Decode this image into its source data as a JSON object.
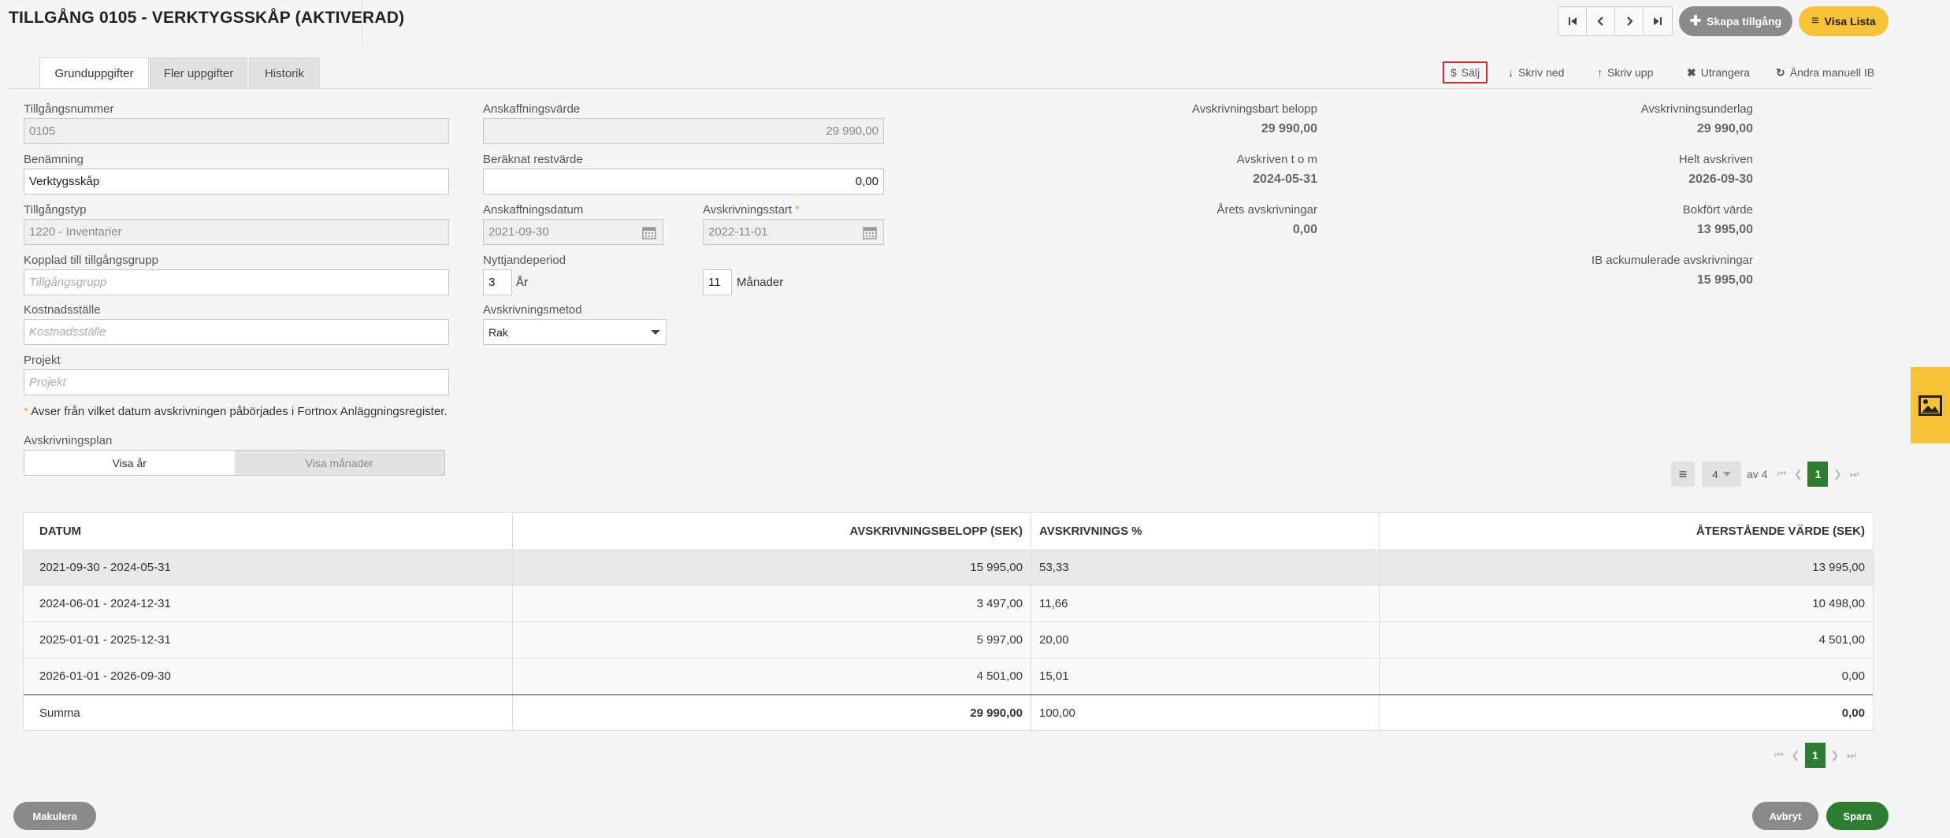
{
  "header": {
    "title": "TILLGÅNG 0105 - VERKTYGSSKÅP (AKTIVERAD)",
    "create_label": "Skapa tillgång",
    "list_label": "Visa Lista"
  },
  "tabs": [
    {
      "label": "Grunduppgifter"
    },
    {
      "label": "Fler uppgifter"
    },
    {
      "label": "Historik"
    }
  ],
  "actions": {
    "sell": "Sälj",
    "write_down": "Skriv ned",
    "write_up": "Skriv upp",
    "dispose": "Utrangera",
    "change_ib": "Ändra manuell IB"
  },
  "form": {
    "asset_number_label": "Tillgångsnummer",
    "asset_number": "0105",
    "name_label": "Benämning",
    "name": "Verktygsskåp",
    "type_label": "Tillgångstyp",
    "type": "1220 - Inventarier",
    "group_label": "Kopplad till tillgångsgrupp",
    "group_placeholder": "Tillgångsgrupp",
    "cost_center_label": "Kostnadsställe",
    "cost_center_placeholder": "Kostnadsställe",
    "project_label": "Projekt",
    "project_placeholder": "Projekt",
    "acq_value_label": "Anskaffningsvärde",
    "acq_value": "29 990,00",
    "residual_label": "Beräknat restvärde",
    "residual": "0,00",
    "acq_date_label": "Anskaffningsdatum",
    "acq_date": "2021-09-30",
    "dep_start_label": "Avskrivningsstart",
    "dep_start": "2022-11-01",
    "useful_life_label": "Nyttjandeperiod",
    "years": "3",
    "years_unit": "År",
    "months": "11",
    "months_unit": "Månader",
    "method_label": "Avskrivningsmetod",
    "method": "Rak",
    "note_star": "*",
    "note": "Avser från vilket datum avskrivningen påbörjades i Fortnox Anläggningsregister.",
    "plan_label": "Avskrivningsplan",
    "view_year": "Visa år",
    "view_month": "Visa månader"
  },
  "summary": {
    "depreciable_label": "Avskrivningsbart belopp",
    "depreciable": "29 990,00",
    "basis_label": "Avskrivningsunderlag",
    "basis": "29 990,00",
    "depreciated_to_label": "Avskriven t o m",
    "depreciated_to": "2024-05-31",
    "fully_label": "Helt avskriven",
    "fully": "2026-09-30",
    "year_dep_label": "Årets avskrivningar",
    "year_dep": "0,00",
    "book_value_label": "Bokfört värde",
    "book_value": "13 995,00",
    "ib_label": "IB ackumulerade avskrivningar",
    "ib": "15 995,00"
  },
  "pager": {
    "per_page": "4",
    "of_text": "av 4",
    "page": "1"
  },
  "table": {
    "headers": [
      "DATUM",
      "AVSKRIVNINGSBELOPP (SEK)",
      "AVSKRIVNINGS %",
      "ÅTERSTÅENDE VÄRDE (SEK)"
    ],
    "rows": [
      [
        "2021-09-30 - 2024-05-31",
        "15 995,00",
        "53,33",
        "13 995,00"
      ],
      [
        "2024-06-01 - 2024-12-31",
        "3 497,00",
        "11,66",
        "10 498,00"
      ],
      [
        "2025-01-01 - 2025-12-31",
        "5 997,00",
        "20,00",
        "4 501,00"
      ],
      [
        "2026-01-01 - 2026-09-30",
        "4 501,00",
        "15,01",
        "0,00"
      ]
    ],
    "total": [
      "Summa",
      "29 990,00",
      "100,00",
      "0,00"
    ]
  },
  "footer": {
    "scrap": "Makulera",
    "cancel": "Avbryt",
    "save": "Spara"
  }
}
